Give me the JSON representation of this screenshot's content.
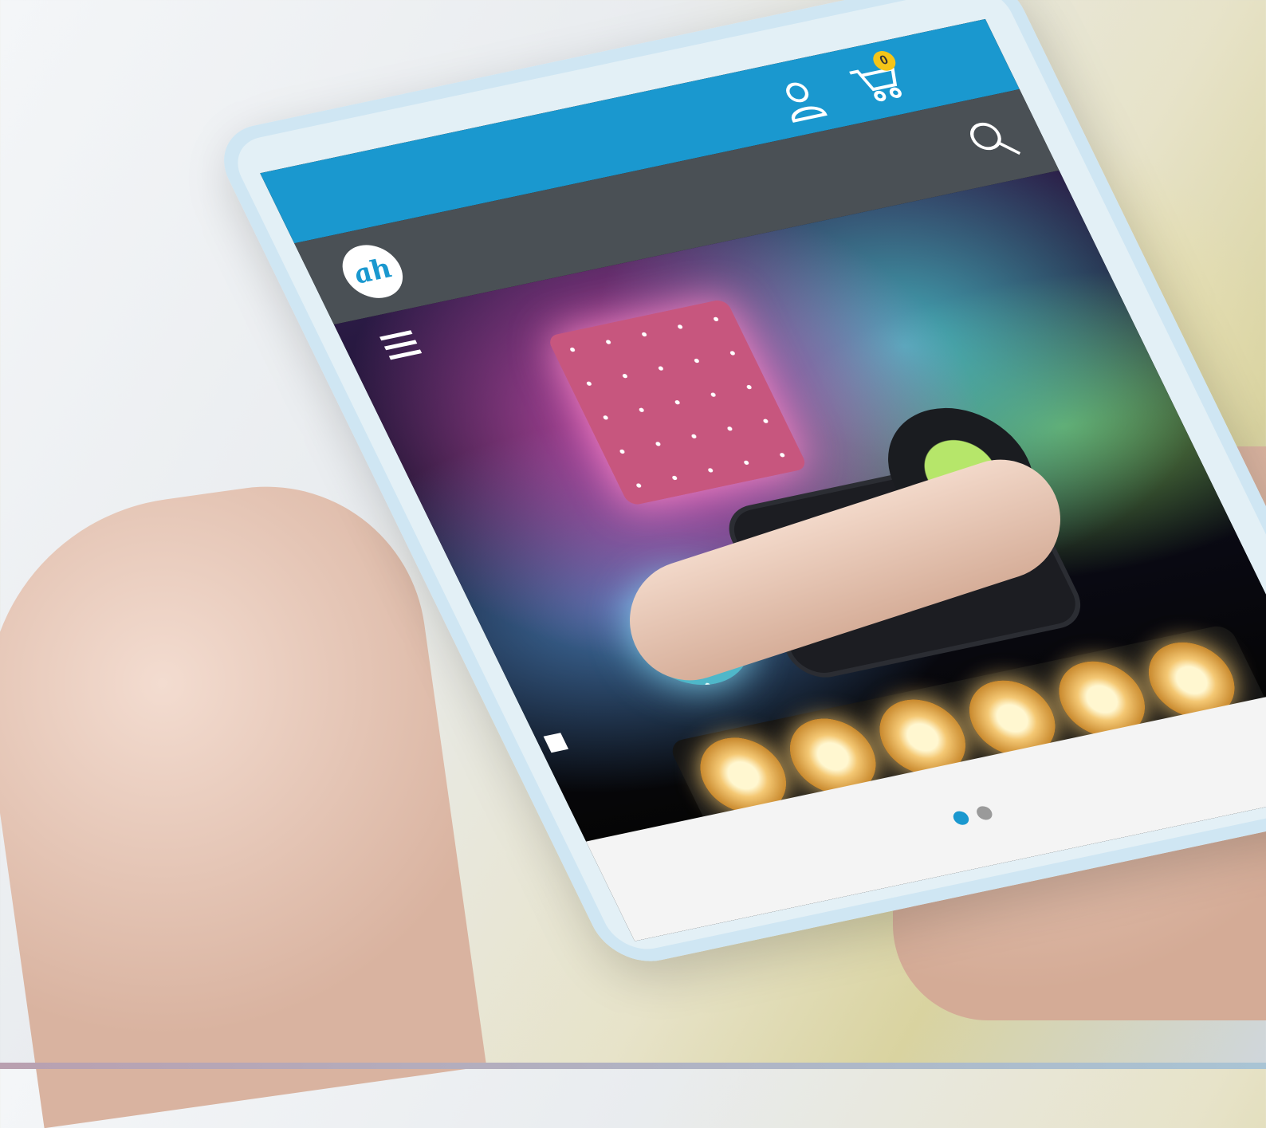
{
  "header": {
    "logo_alt": "ah",
    "user_icon": "user-icon",
    "cart_icon": "cart-icon",
    "cart_count": "0",
    "search_icon": "search-icon",
    "menu_icon": "hamburger-menu-icon"
  },
  "colors": {
    "topbar": "#1a98cf",
    "navbar": "#4a5055",
    "badge": "#f5c518",
    "dot_active": "#1a98cf",
    "dot_inactive": "#9a9a9a"
  },
  "carousel": {
    "slide_count": 2,
    "active_slide": 1
  }
}
